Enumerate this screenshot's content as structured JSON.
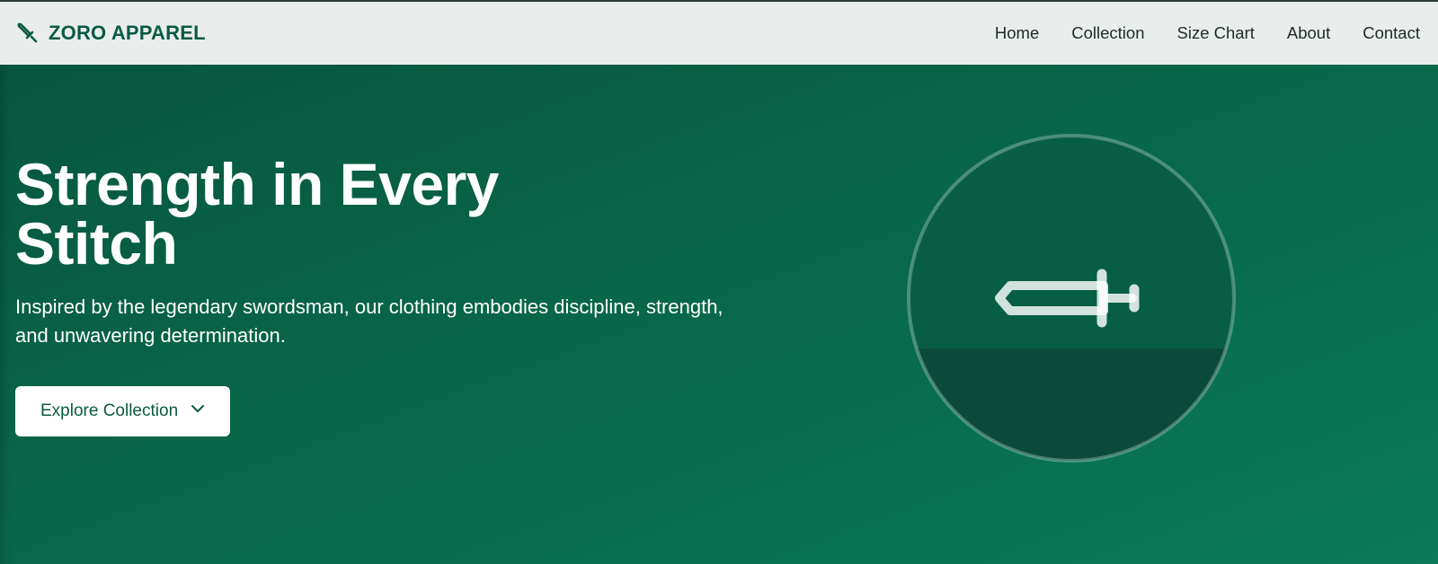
{
  "header": {
    "brand_name": "ZORO APPAREL",
    "brand_icon": "sword-icon",
    "nav": [
      {
        "label": "Home"
      },
      {
        "label": "Collection"
      },
      {
        "label": "Size Chart"
      },
      {
        "label": "About"
      },
      {
        "label": "Contact"
      }
    ]
  },
  "hero": {
    "title": "Strength in Every Stitch",
    "subtitle": "Inspired by the legendary swordsman, our clothing embodies discipline, strength, and unwavering determination.",
    "cta_label": "Explore Collection",
    "cta_icon": "chevron-down-icon",
    "illustration_icon": "sword-icon"
  },
  "colors": {
    "brand": "#0b5a44",
    "header_bg": "#e9eeec",
    "hero_bg_start": "#07563f",
    "hero_bg_end": "#0a7a57",
    "cta_bg": "#ffffff"
  }
}
